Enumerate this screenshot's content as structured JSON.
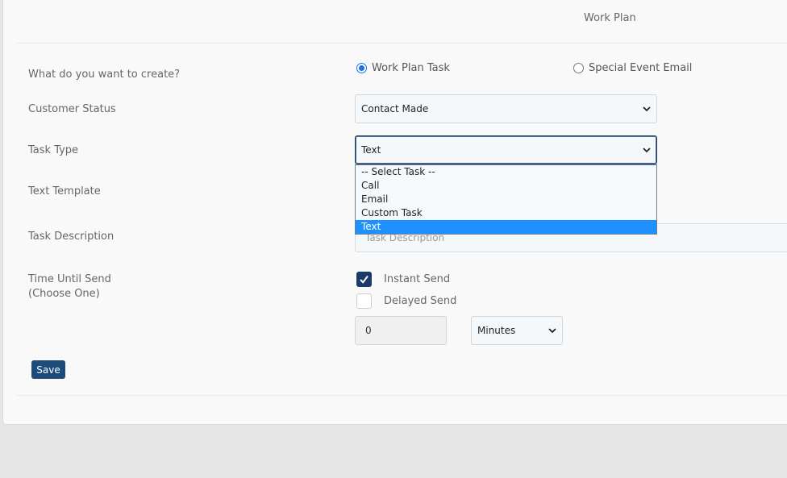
{
  "header": {
    "title": "Work Plan"
  },
  "form": {
    "create": {
      "label": "What do you want to create?",
      "options": [
        "Work Plan Task",
        "Special Event Email"
      ],
      "selected": "Work Plan Task"
    },
    "customer_status": {
      "label": "Customer Status",
      "value": "Contact Made"
    },
    "task_type": {
      "label": "Task Type",
      "value": "Text",
      "options": [
        "-- Select Task --",
        "Call",
        "Email",
        "Custom Task",
        "Text"
      ]
    },
    "text_template": {
      "label": "Text Template"
    },
    "task_description": {
      "label": "Task Description",
      "placeholder": "Task Description"
    },
    "time_until_send": {
      "label_line1": "Time Until Send",
      "label_line2": "(Choose One)",
      "instant_label": "Instant Send",
      "instant_checked": true,
      "delayed_label": "Delayed Send",
      "delayed_checked": false,
      "amount": "0",
      "unit": "Minutes"
    },
    "save_label": "Save"
  },
  "colors": {
    "primary": "#1d4b7a",
    "checkbox_checked": "#193a6b",
    "dropdown_highlight": "#1e90ff",
    "radio_selected": "#1a73e8"
  }
}
